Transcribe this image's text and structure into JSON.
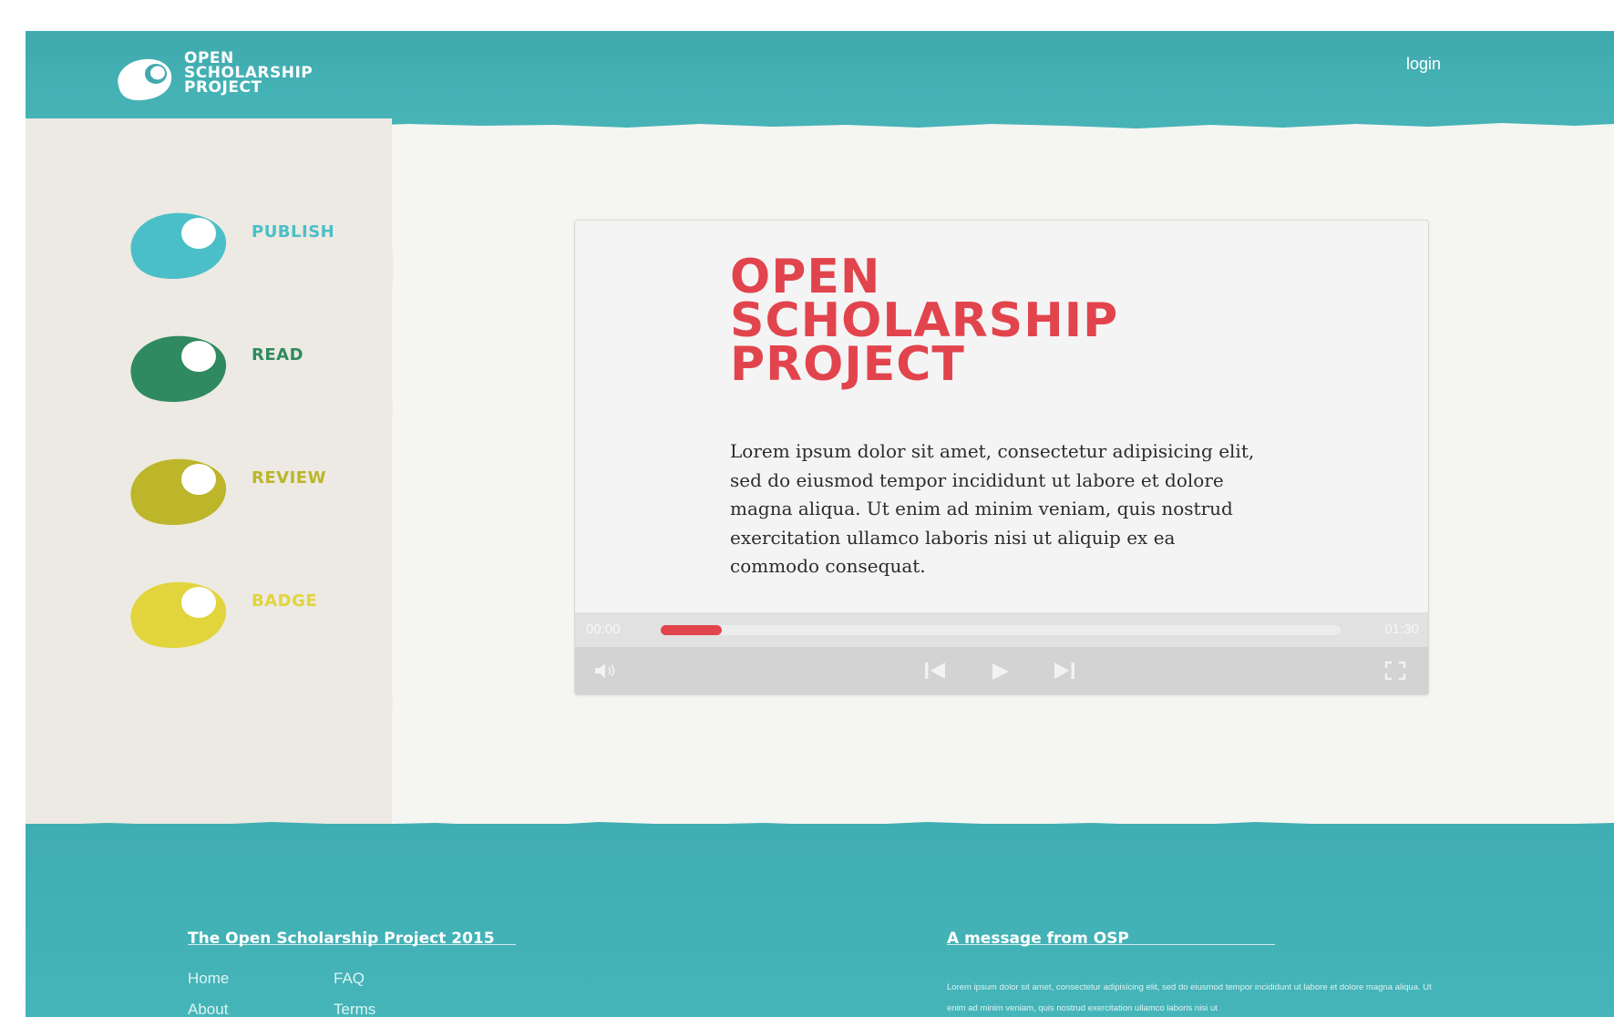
{
  "header": {
    "logo_lines": [
      "OPEN",
      "SCHOLARSHIP",
      "PROJECT"
    ],
    "login_label": "login"
  },
  "sidebar": {
    "items": [
      {
        "label": "PUBLISH",
        "color": "#4bbfc8"
      },
      {
        "label": "READ",
        "color": "#2f8a5f"
      },
      {
        "label": "REVIEW",
        "color": "#bdb52a"
      },
      {
        "label": "BADGE",
        "color": "#e2d43c"
      }
    ]
  },
  "video": {
    "title_lines": [
      "OPEN",
      "SCHOLARSHIP",
      "PROJECT"
    ],
    "body": "Lorem ipsum dolor sit amet, consectetur adipisicing elit, sed do eiusmod tempor incididunt ut labore et dolore magna aliqua. Ut enim ad minim veniam, quis nostrud exercitation ullamco laboris nisi ut aliquip ex ea commodo consequat.",
    "time_current": "00:00",
    "time_total": "01:30",
    "progress_percent": 9
  },
  "footer": {
    "left_title": "The Open Scholarship Project 2015",
    "right_title": "A message from OSP",
    "links": [
      "Home",
      "FAQ",
      "About",
      "Terms"
    ],
    "message": "Lorem ipsum dolor sit amet, consectetur adipisicing elit, sed do eiusmod tempor incididunt ut labore et dolore magna aliqua. Ut enim ad minim veniam, quis nostrud exercitation ullamco laboris nisi ut"
  },
  "colors": {
    "teal": "#45b1b5",
    "accent_red": "#e2444d",
    "paper": "#f5f5f2",
    "sidebar": "#eceae2"
  }
}
